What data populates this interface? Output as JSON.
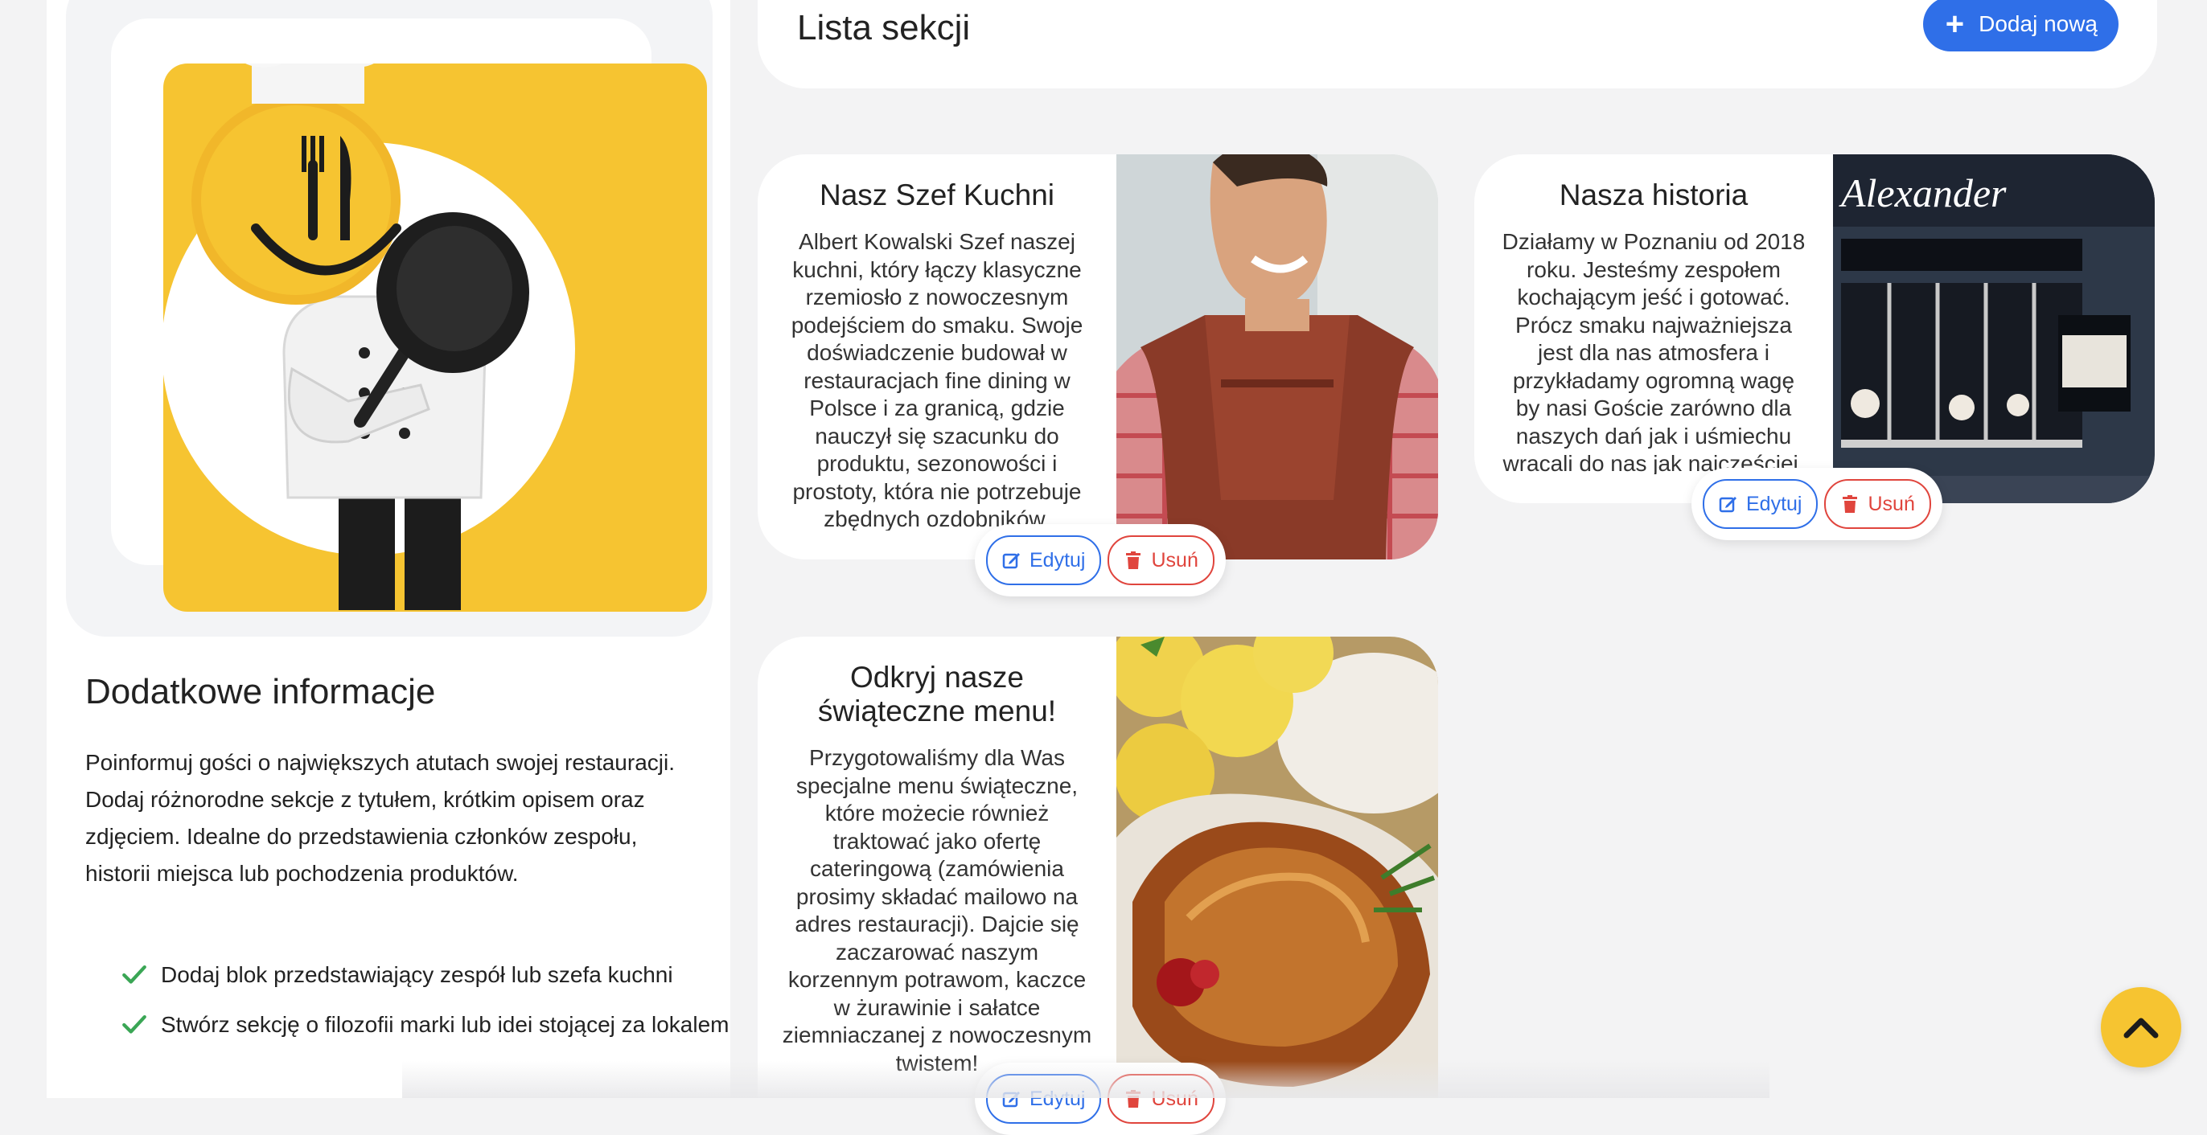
{
  "info": {
    "title": "Dodatkowe informacje",
    "description": "Poinformuj gości o największych atutach swojej restauracji. Dodaj różnorodne sekcje z tytułem, krótkim opisem oraz zdjęciem. Idealne do przedstawienia członków zespołu, historii miejsca lub pochodzenia produktów.",
    "tips": [
      "Dodaj blok przedstawiający zespół lub szefa kuchni",
      "Stwórz sekcję o filozofii marki lub idei stojącej za lokalem"
    ]
  },
  "header": {
    "title": "Lista sekcji",
    "add_label": "Dodaj nową"
  },
  "sections": [
    {
      "title": "Nasz Szef Kuchni",
      "description": "Albert Kowalski Szef naszej kuchni, który łączy klasyczne rzemiosło z nowoczesnym podejściem do smaku. Swoje doświadczenie budował w restauracjach fine dining w Polsce i za granicą, gdzie nauczył się szacunku do produktu, sezonowości i prostoty, która nie potrzebuje zbędnych ozdobników.",
      "edit_label": "Edytuj",
      "delete_label": "Usuń"
    },
    {
      "title": "Nasza historia",
      "description": "Działamy w Poznaniu od 2018 roku. Jesteśmy zespołem kochającym jeść i gotować. Prócz smaku najważniejsza jest dla nas atmosfera i przykładamy ogromną wagę by nasi Goście zarówno dla naszych dań jak i uśmiechu wracali do nas jak najczęściej.",
      "edit_label": "Edytuj",
      "delete_label": "Usuń",
      "image_sign": "Alexander"
    },
    {
      "title": "Odkryj nasze świąteczne menu!",
      "description": "Przygotowaliśmy dla Was specjalne menu świąteczne, które możecie również traktować jako ofertę cateringową (zamówienia prosimy składać mailowo na adres restauracji). Dajcie się zaczarować naszym korzennym potrawom, kaczce w żurawinie i sałatce ziemniaczanej z nowoczesnym twistem!",
      "edit_label": "Edytuj",
      "delete_label": "Usuń"
    }
  ],
  "colors": {
    "accent": "#2f6fe8",
    "danger": "#e0453d",
    "brand_yellow": "#f6c431",
    "check_green": "#3aa655"
  },
  "icons": [
    "plus-icon",
    "edit-icon",
    "trash-icon",
    "check-icon",
    "chevron-up-icon"
  ]
}
